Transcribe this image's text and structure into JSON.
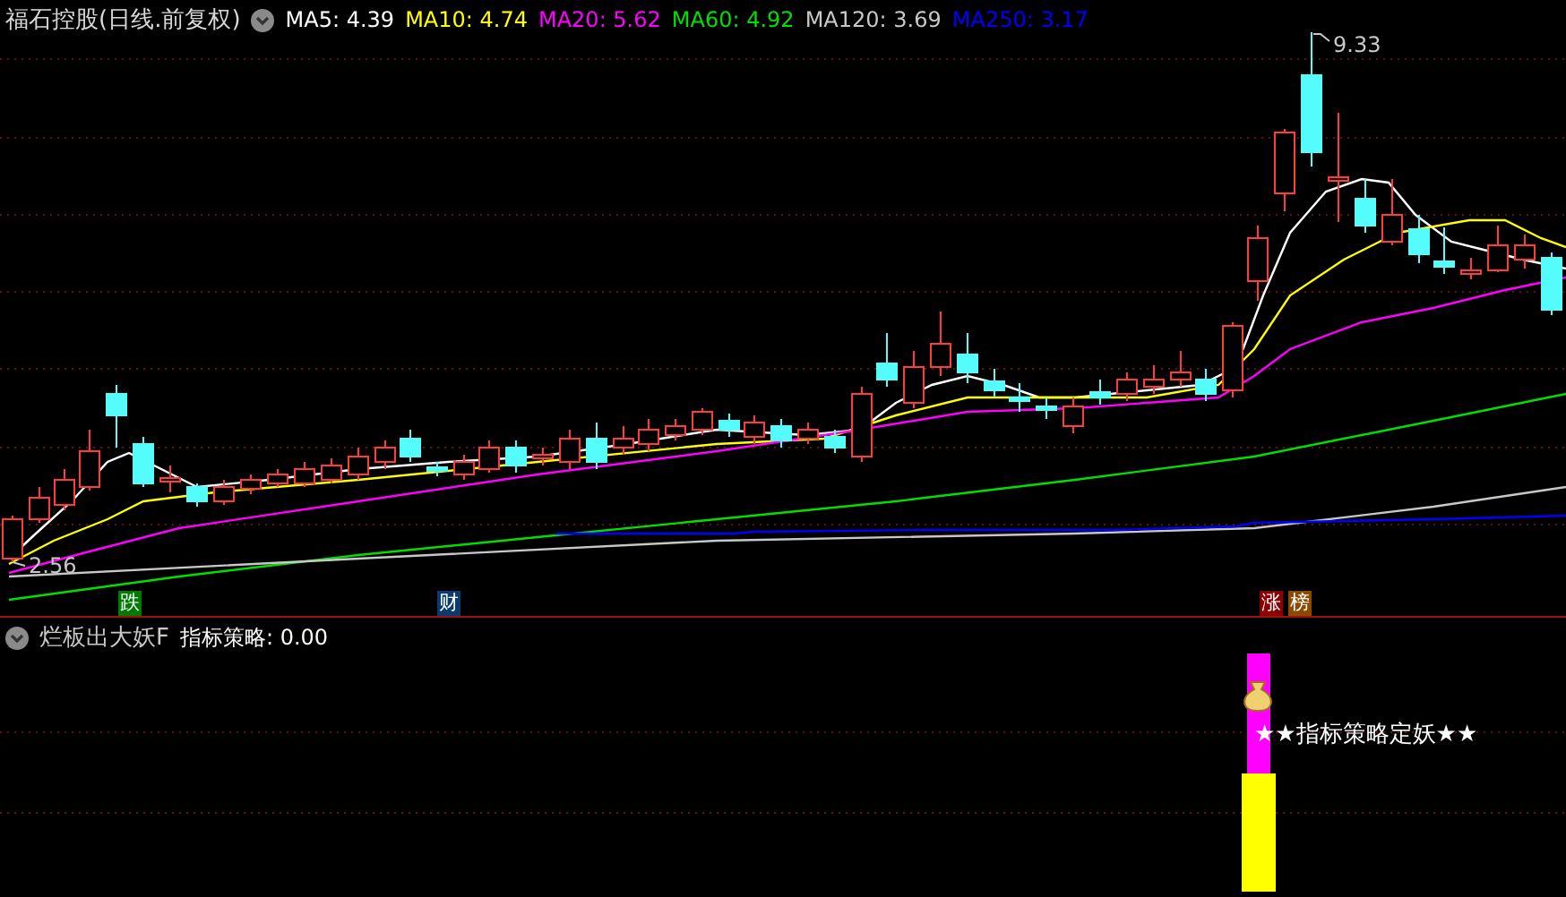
{
  "title": "福石控股(日线.前复权)",
  "ma_legend": [
    {
      "label": "MA5: 4.39",
      "color": "#ffffff"
    },
    {
      "label": "MA10: 4.74",
      "color": "#ffff00"
    },
    {
      "label": "MA20: 5.62",
      "color": "#ff00ff"
    },
    {
      "label": "MA60: 4.92",
      "color": "#00e000"
    },
    {
      "label": "MA120: 3.69",
      "color": "#c8c8c8"
    },
    {
      "label": "MA250: 3.17",
      "color": "#0000ff"
    }
  ],
  "price_labels": {
    "high": "9.33",
    "low": "2.56"
  },
  "event_markers": [
    {
      "label": "跌",
      "color": "#007a00"
    },
    {
      "label": "财",
      "color": "#0a3a6e"
    },
    {
      "label": "涨",
      "color": "#8b0000"
    },
    {
      "label": "榜",
      "color": "#8b4a00"
    }
  ],
  "indicator": {
    "name": "烂板出大妖F",
    "value_label": "指标策略: 0.00",
    "signal_text": "★★指标策略定妖★★"
  }
}
